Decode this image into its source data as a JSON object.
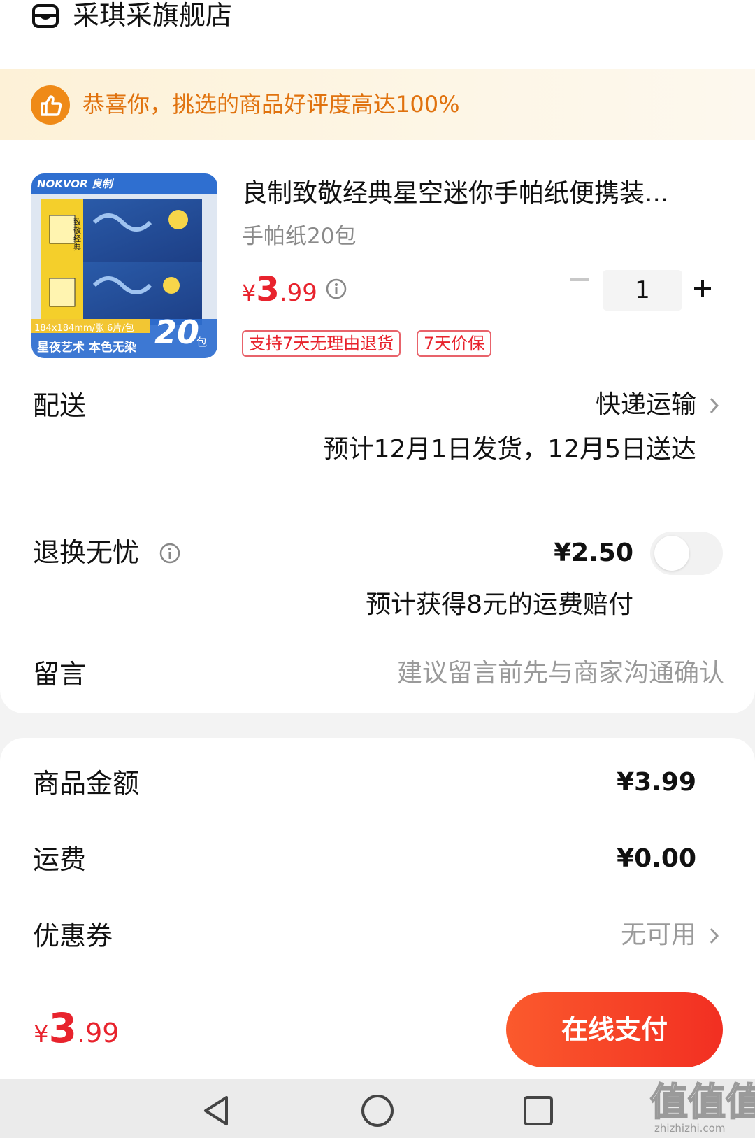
{
  "shop": {
    "name": "采琪采旗舰店",
    "icon": "shop-icon"
  },
  "banner": {
    "icon": "thumbs-up-icon",
    "text": "恭喜你，挑选的商品好评度高达100%"
  },
  "product": {
    "title": "良制致敬经典星空迷你手帕纸便携装...",
    "spec": "手帕纸20包",
    "price_symbol": "¥",
    "price_int": "3",
    "price_dec": ".99",
    "quantity": "1",
    "tags": [
      "支持7天无理由退货",
      "7天价保"
    ],
    "image": {
      "brand": "NOKVOR 良制",
      "badge_line1": "184x184mm/张 6片/包",
      "badge_line2": "星夜艺术 本色无染",
      "count": "20",
      "count_unit": "包",
      "pack_text": "致敬经典"
    }
  },
  "delivery": {
    "label": "配送",
    "method": "快递运输",
    "estimate": "预计12月1日发货，12月5日送达"
  },
  "return_insurance": {
    "label": "退换无忧",
    "price": "¥2.50",
    "note": "预计获得8元的运费赔付",
    "enabled": false
  },
  "message": {
    "label": "留言",
    "placeholder": "建议留言前先与商家沟通确认"
  },
  "summary": {
    "goods_label": "商品金额",
    "goods_value": "¥3.99",
    "shipping_label": "运费",
    "shipping_value": "¥0.00",
    "coupon_label": "优惠券",
    "coupon_value": "无可用"
  },
  "footer": {
    "total_symbol": "¥",
    "total_int": "3",
    "total_dec": ".99",
    "pay_label": "在线支付"
  },
  "watermark": {
    "text": "值值值",
    "sub": "zhizhizhi.com"
  },
  "colors": {
    "accent_red": "#e8232d",
    "banner_orange": "#e0720e",
    "pay_gradient_start": "#fb5a2d"
  }
}
